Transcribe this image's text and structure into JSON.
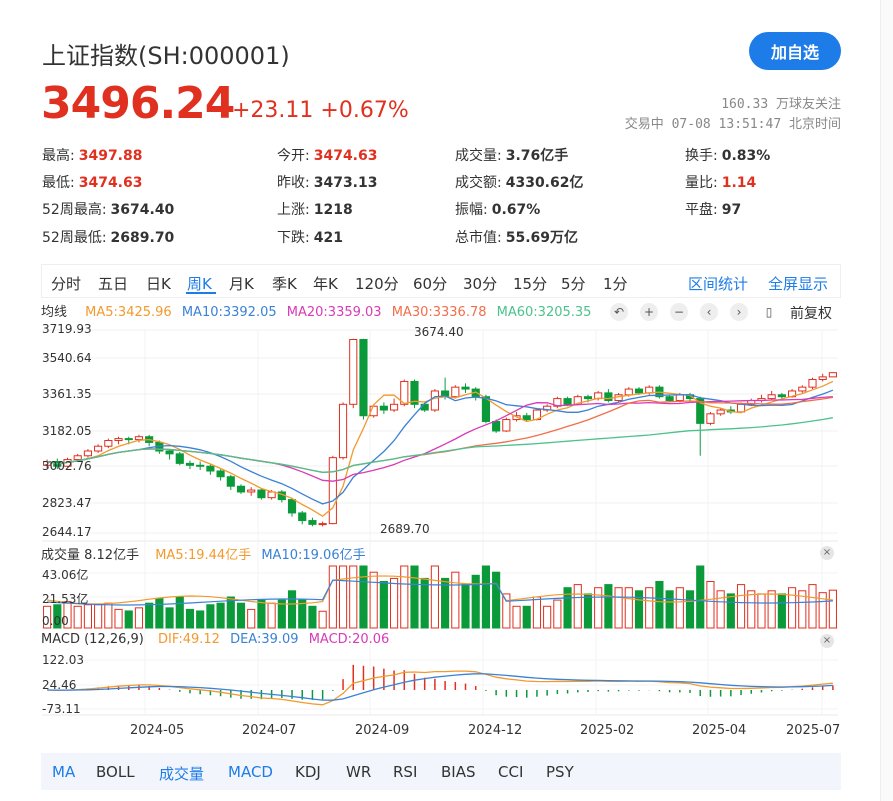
{
  "header": {
    "title": "上证指数(SH:000001)",
    "add_button": "加自选",
    "price": "3496.24",
    "change": "+23.11 +0.67%",
    "followers": "160.33 万球友关注",
    "status_time": "交易中 07-08 13:51:47 北京时间"
  },
  "stats": {
    "high_label": "最高:",
    "high": "3497.88",
    "open_label": "今开:",
    "open": "3474.63",
    "volume_label": "成交量:",
    "volume": "3.76亿手",
    "turnover_label": "换手:",
    "turnover": "0.83%",
    "low_label": "最低:",
    "low": "3474.63",
    "prev_close_label": "昨收:",
    "prev_close": "3473.13",
    "amount_label": "成交额:",
    "amount": "4330.62亿",
    "vol_ratio_label": "量比:",
    "vol_ratio": "1.14",
    "w52_high_label": "52周最高:",
    "w52_high": "3674.40",
    "up_label": "上涨:",
    "up": "1218",
    "amplitude_label": "振幅:",
    "amplitude": "0.67%",
    "flat_label": "平盘:",
    "flat": "97",
    "w52_low_label": "52周最低:",
    "w52_low": "2689.70",
    "down_label": "下跌:",
    "down": "421",
    "mcap_label": "总市值:",
    "mcap": "55.69万亿"
  },
  "period_tabs": [
    "分时",
    "五日",
    "日K",
    "周K",
    "月K",
    "季K",
    "年K",
    "120分",
    "60分",
    "30分",
    "15分",
    "5分",
    "1分"
  ],
  "period_active": "周K",
  "tools": {
    "range_stats": "区间统计",
    "fullscreen": "全屏显示",
    "adjust": "前复权"
  },
  "ma_legend": {
    "label": "均线",
    "ma5": "MA5:3425.96",
    "ma10": "MA10:3392.05",
    "ma20": "MA20:3359.03",
    "ma30": "MA30:3336.78",
    "ma60": "MA60:3205.35"
  },
  "colors": {
    "up": "#e03020",
    "down": "#0a9a3a",
    "accent": "#1e7ce8",
    "ma5": "#f29a2e",
    "ma10": "#3a82d6",
    "ma20": "#d93ab6",
    "ma30": "#f26e4a",
    "ma60": "#4cc28e"
  },
  "volume_legend": {
    "label": "成交量 8.12亿手",
    "ma5": "MA5:19.44亿手",
    "ma10": "MA10:19.06亿手"
  },
  "macd_legend": {
    "label": "MACD (12,26,9)",
    "dif": "DIF:49.12",
    "dea": "DEA:39.09",
    "macd": "MACD:20.06"
  },
  "icons": [
    "undo-icon",
    "zoom-in-icon",
    "zoom-out-icon",
    "chevron-left-icon",
    "chevron-right-icon",
    "candle-icon",
    "close-icon"
  ],
  "indicator_tabs": [
    "MA",
    "BOLL",
    "成交量",
    "MACD",
    "KDJ",
    "WR",
    "RSI",
    "BIAS",
    "CCI",
    "PSY"
  ],
  "indicator_active": [
    "成交量",
    "MACD"
  ],
  "chart_data": {
    "type": "candlestick",
    "y_ticks": [
      "3719.93",
      "3540.64",
      "3361.35",
      "3182.05",
      "3002.76",
      "2823.47",
      "2644.17"
    ],
    "ylim": [
      2644.17,
      3719.93
    ],
    "annotations": {
      "max": "3674.40",
      "min": "2689.70"
    },
    "x_ticks": [
      "2024-05",
      "2024-07",
      "2024-09",
      "2024-12",
      "2025-02",
      "2025-04",
      "2025-07"
    ],
    "volume_ticks": [
      "43.06亿",
      "21.53亿",
      "0.00"
    ],
    "macd_ticks": [
      "122.03",
      "24.46",
      "-73.11"
    ],
    "candles": [
      [
        3010,
        3030,
        2995,
        3040
      ],
      [
        3030,
        3005,
        2990,
        3045
      ],
      [
        3005,
        3040,
        3000,
        3050
      ],
      [
        3040,
        3060,
        3030,
        3070
      ],
      [
        3060,
        3085,
        3050,
        3095
      ],
      [
        3085,
        3110,
        3075,
        3120
      ],
      [
        3110,
        3140,
        3100,
        3150
      ],
      [
        3140,
        3150,
        3120,
        3160
      ],
      [
        3150,
        3145,
        3120,
        3160
      ],
      [
        3145,
        3160,
        3130,
        3170
      ],
      [
        3160,
        3130,
        3110,
        3170
      ],
      [
        3130,
        3085,
        3070,
        3140
      ],
      [
        3085,
        3070,
        3040,
        3095
      ],
      [
        3070,
        3020,
        3010,
        3080
      ],
      [
        3020,
        3010,
        2990,
        3035
      ],
      [
        3010,
        3005,
        2985,
        3030
      ],
      [
        3005,
        2980,
        2960,
        3015
      ],
      [
        2980,
        2950,
        2930,
        2990
      ],
      [
        2950,
        2900,
        2880,
        2960
      ],
      [
        2900,
        2870,
        2860,
        2910
      ],
      [
        2870,
        2880,
        2850,
        2895
      ],
      [
        2880,
        2840,
        2830,
        2890
      ],
      [
        2840,
        2870,
        2830,
        2880
      ],
      [
        2870,
        2830,
        2815,
        2880
      ],
      [
        2830,
        2760,
        2740,
        2840
      ],
      [
        2760,
        2720,
        2700,
        2770
      ],
      [
        2720,
        2700,
        2690,
        2735
      ],
      [
        2700,
        2704,
        2689,
        2715
      ],
      [
        2704,
        3050,
        2700,
        3060
      ],
      [
        3050,
        3330,
        3040,
        3340
      ],
      [
        3330,
        3670,
        3310,
        3674
      ],
      [
        3670,
        3270,
        3250,
        3674
      ],
      [
        3270,
        3320,
        3260,
        3330
      ],
      [
        3320,
        3300,
        3280,
        3340
      ],
      [
        3300,
        3330,
        3290,
        3360
      ],
      [
        3330,
        3450,
        3320,
        3460
      ],
      [
        3450,
        3330,
        3310,
        3460
      ],
      [
        3330,
        3300,
        3290,
        3340
      ],
      [
        3300,
        3400,
        3290,
        3410
      ],
      [
        3400,
        3370,
        3355,
        3470
      ],
      [
        3370,
        3420,
        3360,
        3430
      ],
      [
        3420,
        3410,
        3390,
        3440
      ],
      [
        3410,
        3370,
        3350,
        3420
      ],
      [
        3370,
        3240,
        3230,
        3380
      ],
      [
        3240,
        3190,
        3180,
        3250
      ],
      [
        3190,
        3250,
        3185,
        3260
      ],
      [
        3250,
        3270,
        3240,
        3290
      ],
      [
        3270,
        3250,
        3240,
        3285
      ],
      [
        3250,
        3300,
        3245,
        3310
      ],
      [
        3300,
        3320,
        3290,
        3330
      ],
      [
        3320,
        3360,
        3310,
        3370
      ],
      [
        3360,
        3330,
        3320,
        3370
      ],
      [
        3330,
        3370,
        3325,
        3380
      ],
      [
        3370,
        3360,
        3340,
        3380
      ],
      [
        3360,
        3390,
        3350,
        3400
      ],
      [
        3390,
        3350,
        3340,
        3410
      ],
      [
        3350,
        3380,
        3340,
        3390
      ],
      [
        3380,
        3410,
        3370,
        3420
      ],
      [
        3410,
        3390,
        3380,
        3420
      ],
      [
        3390,
        3420,
        3380,
        3430
      ],
      [
        3420,
        3370,
        3360,
        3430
      ],
      [
        3370,
        3350,
        3340,
        3380
      ],
      [
        3350,
        3380,
        3340,
        3390
      ],
      [
        3380,
        3360,
        3350,
        3390
      ],
      [
        3360,
        3230,
        3060,
        3370
      ],
      [
        3230,
        3280,
        3220,
        3290
      ],
      [
        3280,
        3300,
        3270,
        3310
      ],
      [
        3300,
        3290,
        3280,
        3320
      ],
      [
        3290,
        3330,
        3285,
        3340
      ],
      [
        3330,
        3350,
        3320,
        3360
      ],
      [
        3350,
        3360,
        3340,
        3380
      ],
      [
        3360,
        3380,
        3350,
        3400
      ],
      [
        3380,
        3370,
        3360,
        3390
      ],
      [
        3370,
        3400,
        3365,
        3410
      ],
      [
        3400,
        3420,
        3390,
        3430
      ],
      [
        3420,
        3460,
        3410,
        3470
      ],
      [
        3460,
        3474,
        3450,
        3490
      ],
      [
        3474,
        3496,
        3474,
        3498
      ]
    ]
  }
}
